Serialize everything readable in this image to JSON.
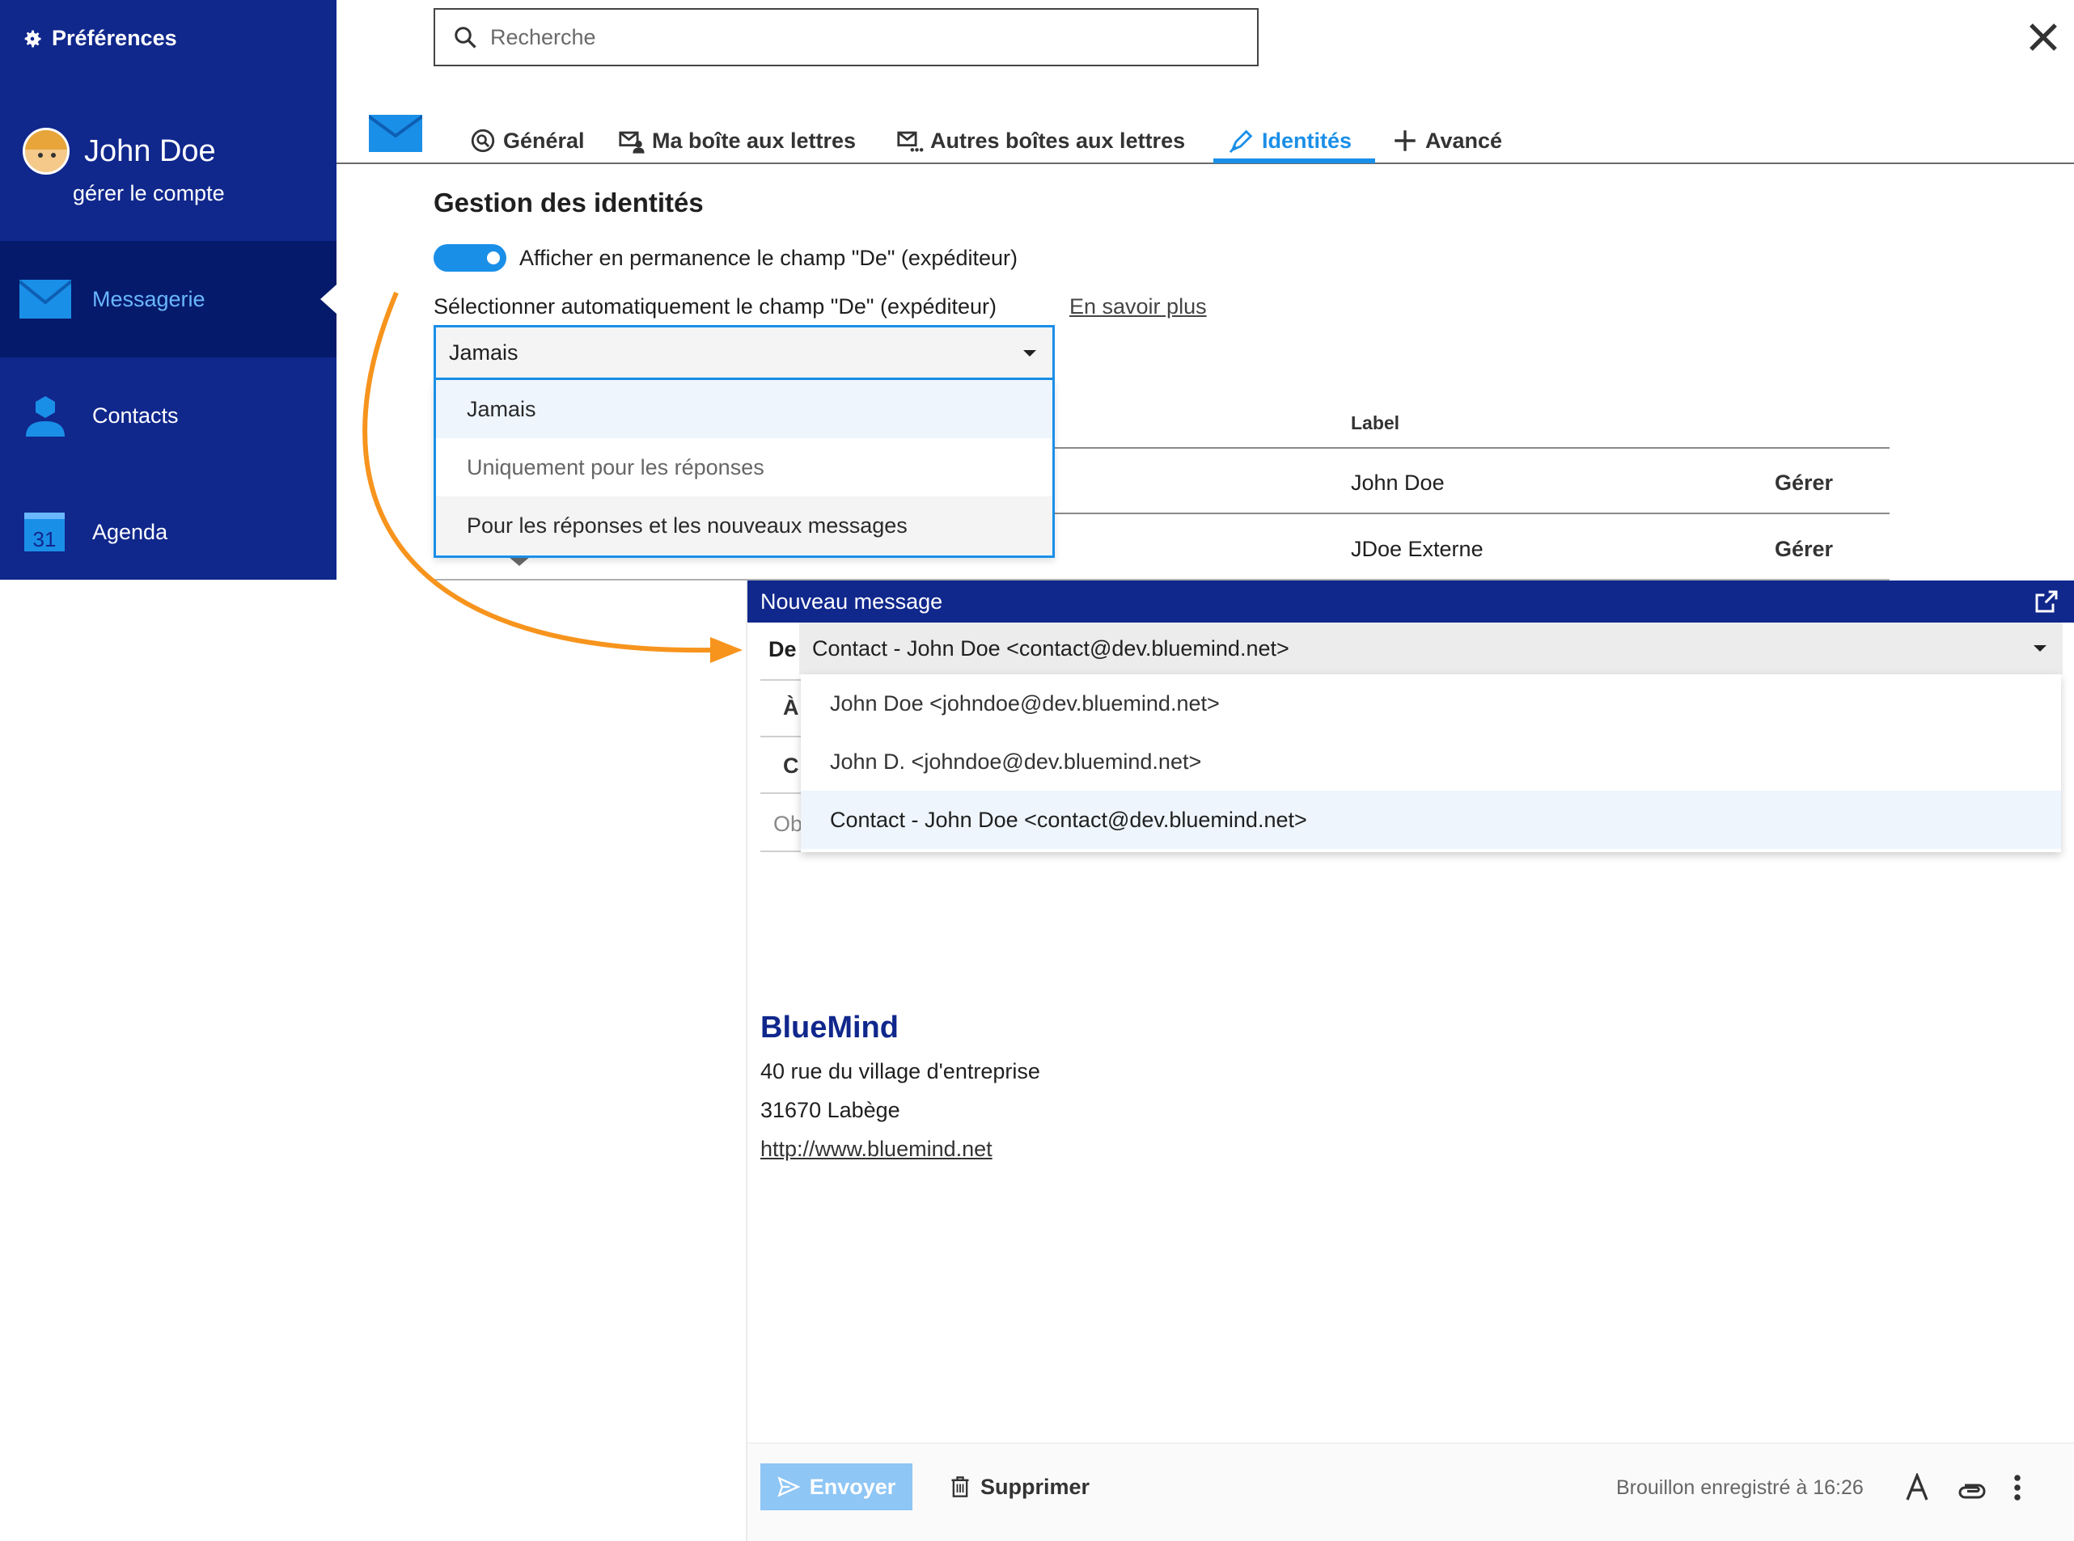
{
  "sidebar": {
    "title": "Préférences",
    "user_name": "John Doe",
    "manage_account": "gérer le compte",
    "items": [
      {
        "label": "Messagerie",
        "icon": "mail-icon"
      },
      {
        "label": "Contacts",
        "icon": "contacts-icon"
      },
      {
        "label": "Agenda",
        "icon": "calendar-icon",
        "badge": "31"
      }
    ]
  },
  "search": {
    "placeholder": "Recherche"
  },
  "tabs": [
    {
      "label": "Général",
      "icon": "general-icon"
    },
    {
      "label": "Ma boîte aux lettres",
      "icon": "my-mailbox-icon"
    },
    {
      "label": "Autres boîtes aux lettres",
      "icon": "other-mailboxes-icon"
    },
    {
      "label": "Identités",
      "icon": "pen-icon",
      "active": true
    },
    {
      "label": "Avancé",
      "icon": "plus-icon"
    }
  ],
  "identities": {
    "title": "Gestion des identités",
    "toggle_label": "Afficher en permanence le champ \"De\" (expéditeur)",
    "toggle_on": true,
    "select_label": "Sélectionner automatiquement le champ \"De\" (expéditeur)",
    "learn_more": "En savoir plus",
    "selected": "Jamais",
    "options": [
      "Jamais",
      "Uniquement pour les réponses",
      "Pour les réponses et les nouveaux messages"
    ],
    "column_label": "Label",
    "rows": [
      {
        "label": "John Doe",
        "action": "Gérer"
      },
      {
        "label": "JDoe Externe",
        "action": "Gérer"
      }
    ]
  },
  "composer": {
    "title": "Nouveau message",
    "from_label": "De",
    "from_value": "Contact - John Doe <contact@dev.bluemind.net>",
    "hidden_to": "À",
    "hidden_cc": "C",
    "hidden_subject": "Ob",
    "from_options": [
      "John Doe <johndoe@dev.bluemind.net>",
      "John D. <johndoe@dev.bluemind.net>",
      "Contact - John Doe <contact@dev.bluemind.net>"
    ],
    "signature": {
      "company": "BlueMind",
      "address1": "40 rue du village d'entreprise",
      "address2": "31670 Labège",
      "url": "http://www.bluemind.net"
    },
    "send_label": "Envoyer",
    "delete_label": "Supprimer",
    "draft_status": "Brouillon enregistré à 16:26"
  },
  "colors": {
    "sidebar_bg": "#10278c",
    "sidebar_active_bg": "#061a6b",
    "accent": "#1a8fe8",
    "annotation_arrow": "#f7941d",
    "send_button": "#8ec6f5"
  }
}
